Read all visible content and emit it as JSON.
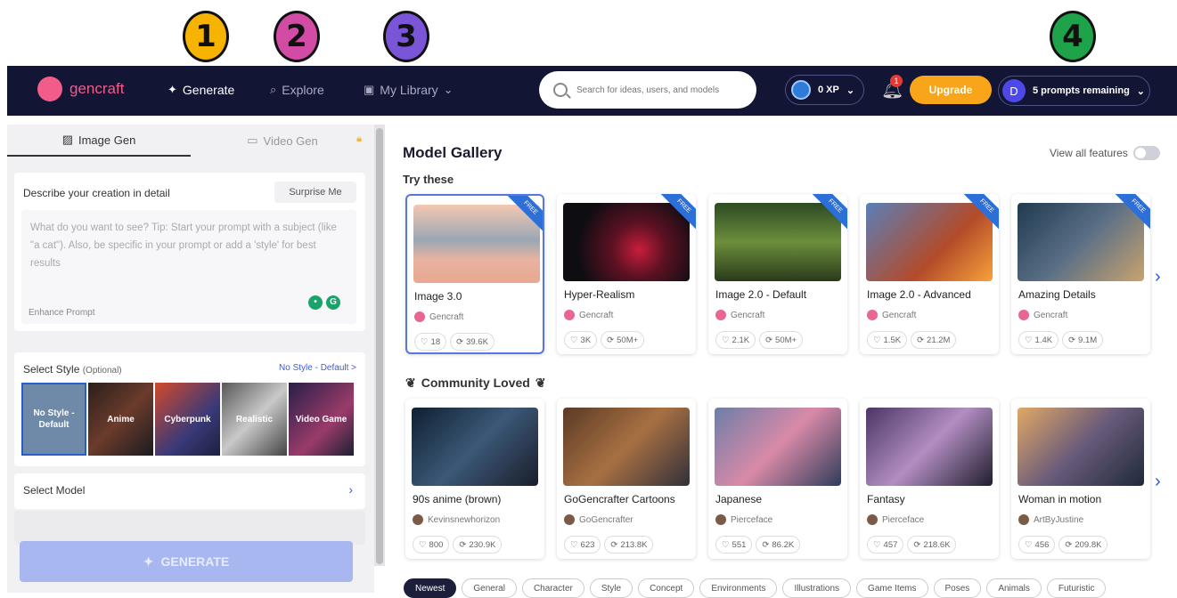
{
  "annotations": [
    "1",
    "2",
    "3",
    "4"
  ],
  "nav": {
    "logo": "gencraft",
    "generate": "Generate",
    "explore": "Explore",
    "library": "My Library",
    "search_placeholder": "Search for ideas, users, and models",
    "xp": "0 XP",
    "notifications": "1",
    "upgrade": "Upgrade",
    "avatar": "D",
    "prompts": "5 prompts remaining"
  },
  "left": {
    "tab_image": "Image Gen",
    "tab_video": "Video Gen",
    "describe_label": "Describe your creation in detail",
    "surprise": "Surprise Me",
    "prompt_placeholder": "What do you want to see? Tip: Start your prompt with a subject (like \"a cat\"). Also, be specific in your prompt or add a 'style' for best results",
    "enhance": "Enhance Prompt",
    "style_label": "Select Style",
    "style_optional": "(Optional)",
    "style_link": "No Style - Default >",
    "styles": [
      "No Style - Default",
      "Anime",
      "Cyberpunk",
      "Realistic",
      "Video Game"
    ],
    "model_label": "Select Model",
    "generate_button": "GENERATE"
  },
  "gallery": {
    "title": "Model Gallery",
    "view_all": "View all features",
    "try_these": "Try these",
    "community": "Community Loved",
    "try_models": [
      {
        "name": "Image 3.0",
        "author": "Gencraft",
        "likes": "18",
        "uses": "39.6K",
        "badge": "FREE"
      },
      {
        "name": "Hyper-Realism",
        "author": "Gencraft",
        "likes": "3K",
        "uses": "50M+",
        "badge": "FREE"
      },
      {
        "name": "Image 2.0 - Default",
        "author": "Gencraft",
        "likes": "2.1K",
        "uses": "50M+",
        "badge": "FREE"
      },
      {
        "name": "Image 2.0 - Advanced",
        "author": "Gencraft",
        "likes": "1.5K",
        "uses": "21.2M",
        "badge": "FREE"
      },
      {
        "name": "Amazing Details",
        "author": "Gencraft",
        "likes": "1.4K",
        "uses": "9.1M",
        "badge": "FREE"
      }
    ],
    "community_models": [
      {
        "name": "90s anime (brown)",
        "author": "Kevinsnewhorizon",
        "likes": "800",
        "uses": "230.9K"
      },
      {
        "name": "GoGencrafter Cartoons",
        "author": "GoGencrafter",
        "likes": "623",
        "uses": "213.8K"
      },
      {
        "name": "Japanese",
        "author": "Pierceface",
        "likes": "551",
        "uses": "86.2K"
      },
      {
        "name": "Fantasy",
        "author": "Pierceface",
        "likes": "457",
        "uses": "218.6K"
      },
      {
        "name": "Woman in motion",
        "author": "ArtByJustine",
        "likes": "456",
        "uses": "209.8K"
      }
    ],
    "categories": [
      "Newest",
      "General",
      "Character",
      "Style",
      "Concept",
      "Environments",
      "Illustrations",
      "Game Items",
      "Poses",
      "Animals",
      "Futuristic"
    ]
  }
}
